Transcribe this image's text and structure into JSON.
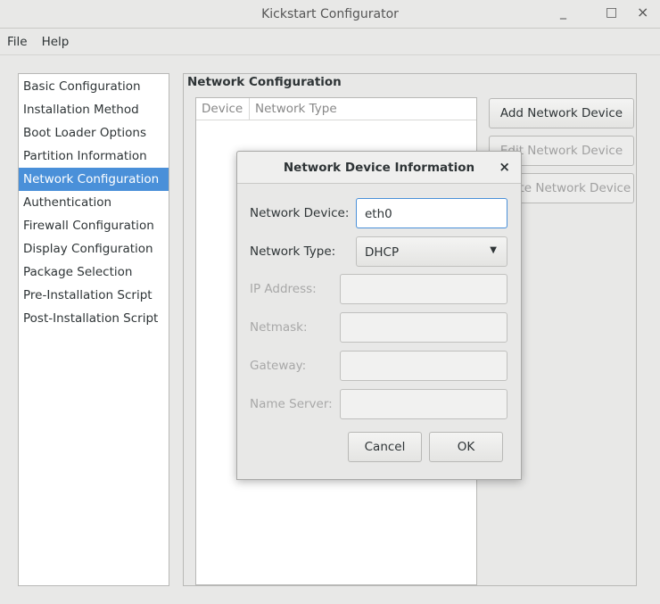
{
  "window": {
    "title": "Kickstart Configurator",
    "minimize": "_",
    "maximize": "□",
    "close": "×"
  },
  "menu": [
    "File",
    "Help"
  ],
  "sidebar": {
    "items": [
      "Basic Configuration",
      "Installation Method",
      "Boot Loader Options",
      "Partition Information",
      "Network Configuration",
      "Authentication",
      "Firewall Configuration",
      "Display Configuration",
      "Package Selection",
      "Pre-Installation Script",
      "Post-Installation Script"
    ],
    "selected": "Network Configuration"
  },
  "main": {
    "frame_title": "Network Configuration",
    "columns": [
      "Device",
      "Network Type"
    ],
    "buttons": {
      "add": "Add Network Device",
      "edit": "Edit Network Device",
      "delete": "Delete Network Device"
    }
  },
  "dialog": {
    "title": "Network Device Information",
    "close": "×",
    "network_device_label": "Network Device:",
    "network_device_value": "eth0",
    "network_type_label": "Network Type:",
    "network_type_value": "DHCP",
    "ip_label": "IP Address:",
    "netmask_label": "Netmask:",
    "gateway_label": "Gateway:",
    "nameserver_label": "Name Server:",
    "cancel": "Cancel",
    "ok": "OK"
  },
  "colors": {
    "accent": "#4a90d9",
    "focus_border": "#4a90d9"
  }
}
